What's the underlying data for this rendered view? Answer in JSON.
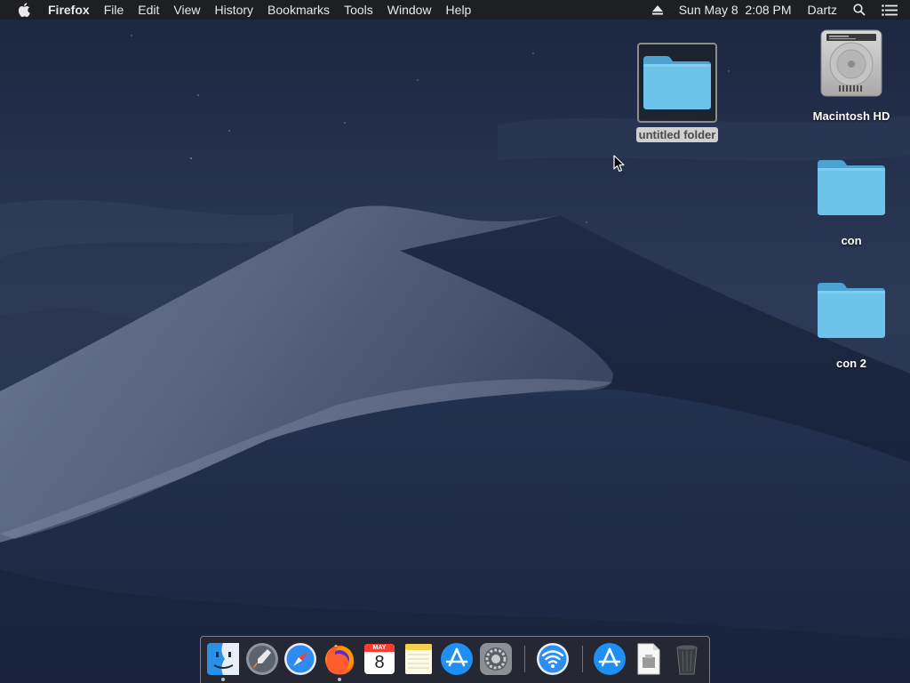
{
  "menubar": {
    "app_name": "Firefox",
    "menus": [
      "File",
      "Edit",
      "View",
      "History",
      "Bookmarks",
      "Tools",
      "Window",
      "Help"
    ],
    "datetime": "Sun May 8  2:08 PM",
    "user": "Dartz",
    "icons": [
      "apple-icon",
      "eject-icon",
      "spotlight-icon",
      "notification-center-icon"
    ]
  },
  "desktop": {
    "icons": [
      {
        "label": "untitled folder",
        "kind": "folder",
        "selected": true
      },
      {
        "label": "Macintosh HD",
        "kind": "hard-drive"
      },
      {
        "label": "con",
        "kind": "folder"
      },
      {
        "label": "con 2",
        "kind": "folder"
      }
    ]
  },
  "dock": {
    "calendar_month": "MAY",
    "calendar_day": "8",
    "items": [
      "finder",
      "launchpad",
      "safari",
      "firefox",
      "calendar",
      "notes",
      "app-store",
      "system-preferences",
      "wifi-utility",
      "app-store-downloads",
      "document",
      "trash"
    ],
    "running": [
      "finder",
      "firefox"
    ]
  },
  "colors": {
    "menubar_bg": "#1e1f22",
    "folder_blue": "#5fb8e0",
    "selection_label_bg": "#d0d0d0"
  }
}
